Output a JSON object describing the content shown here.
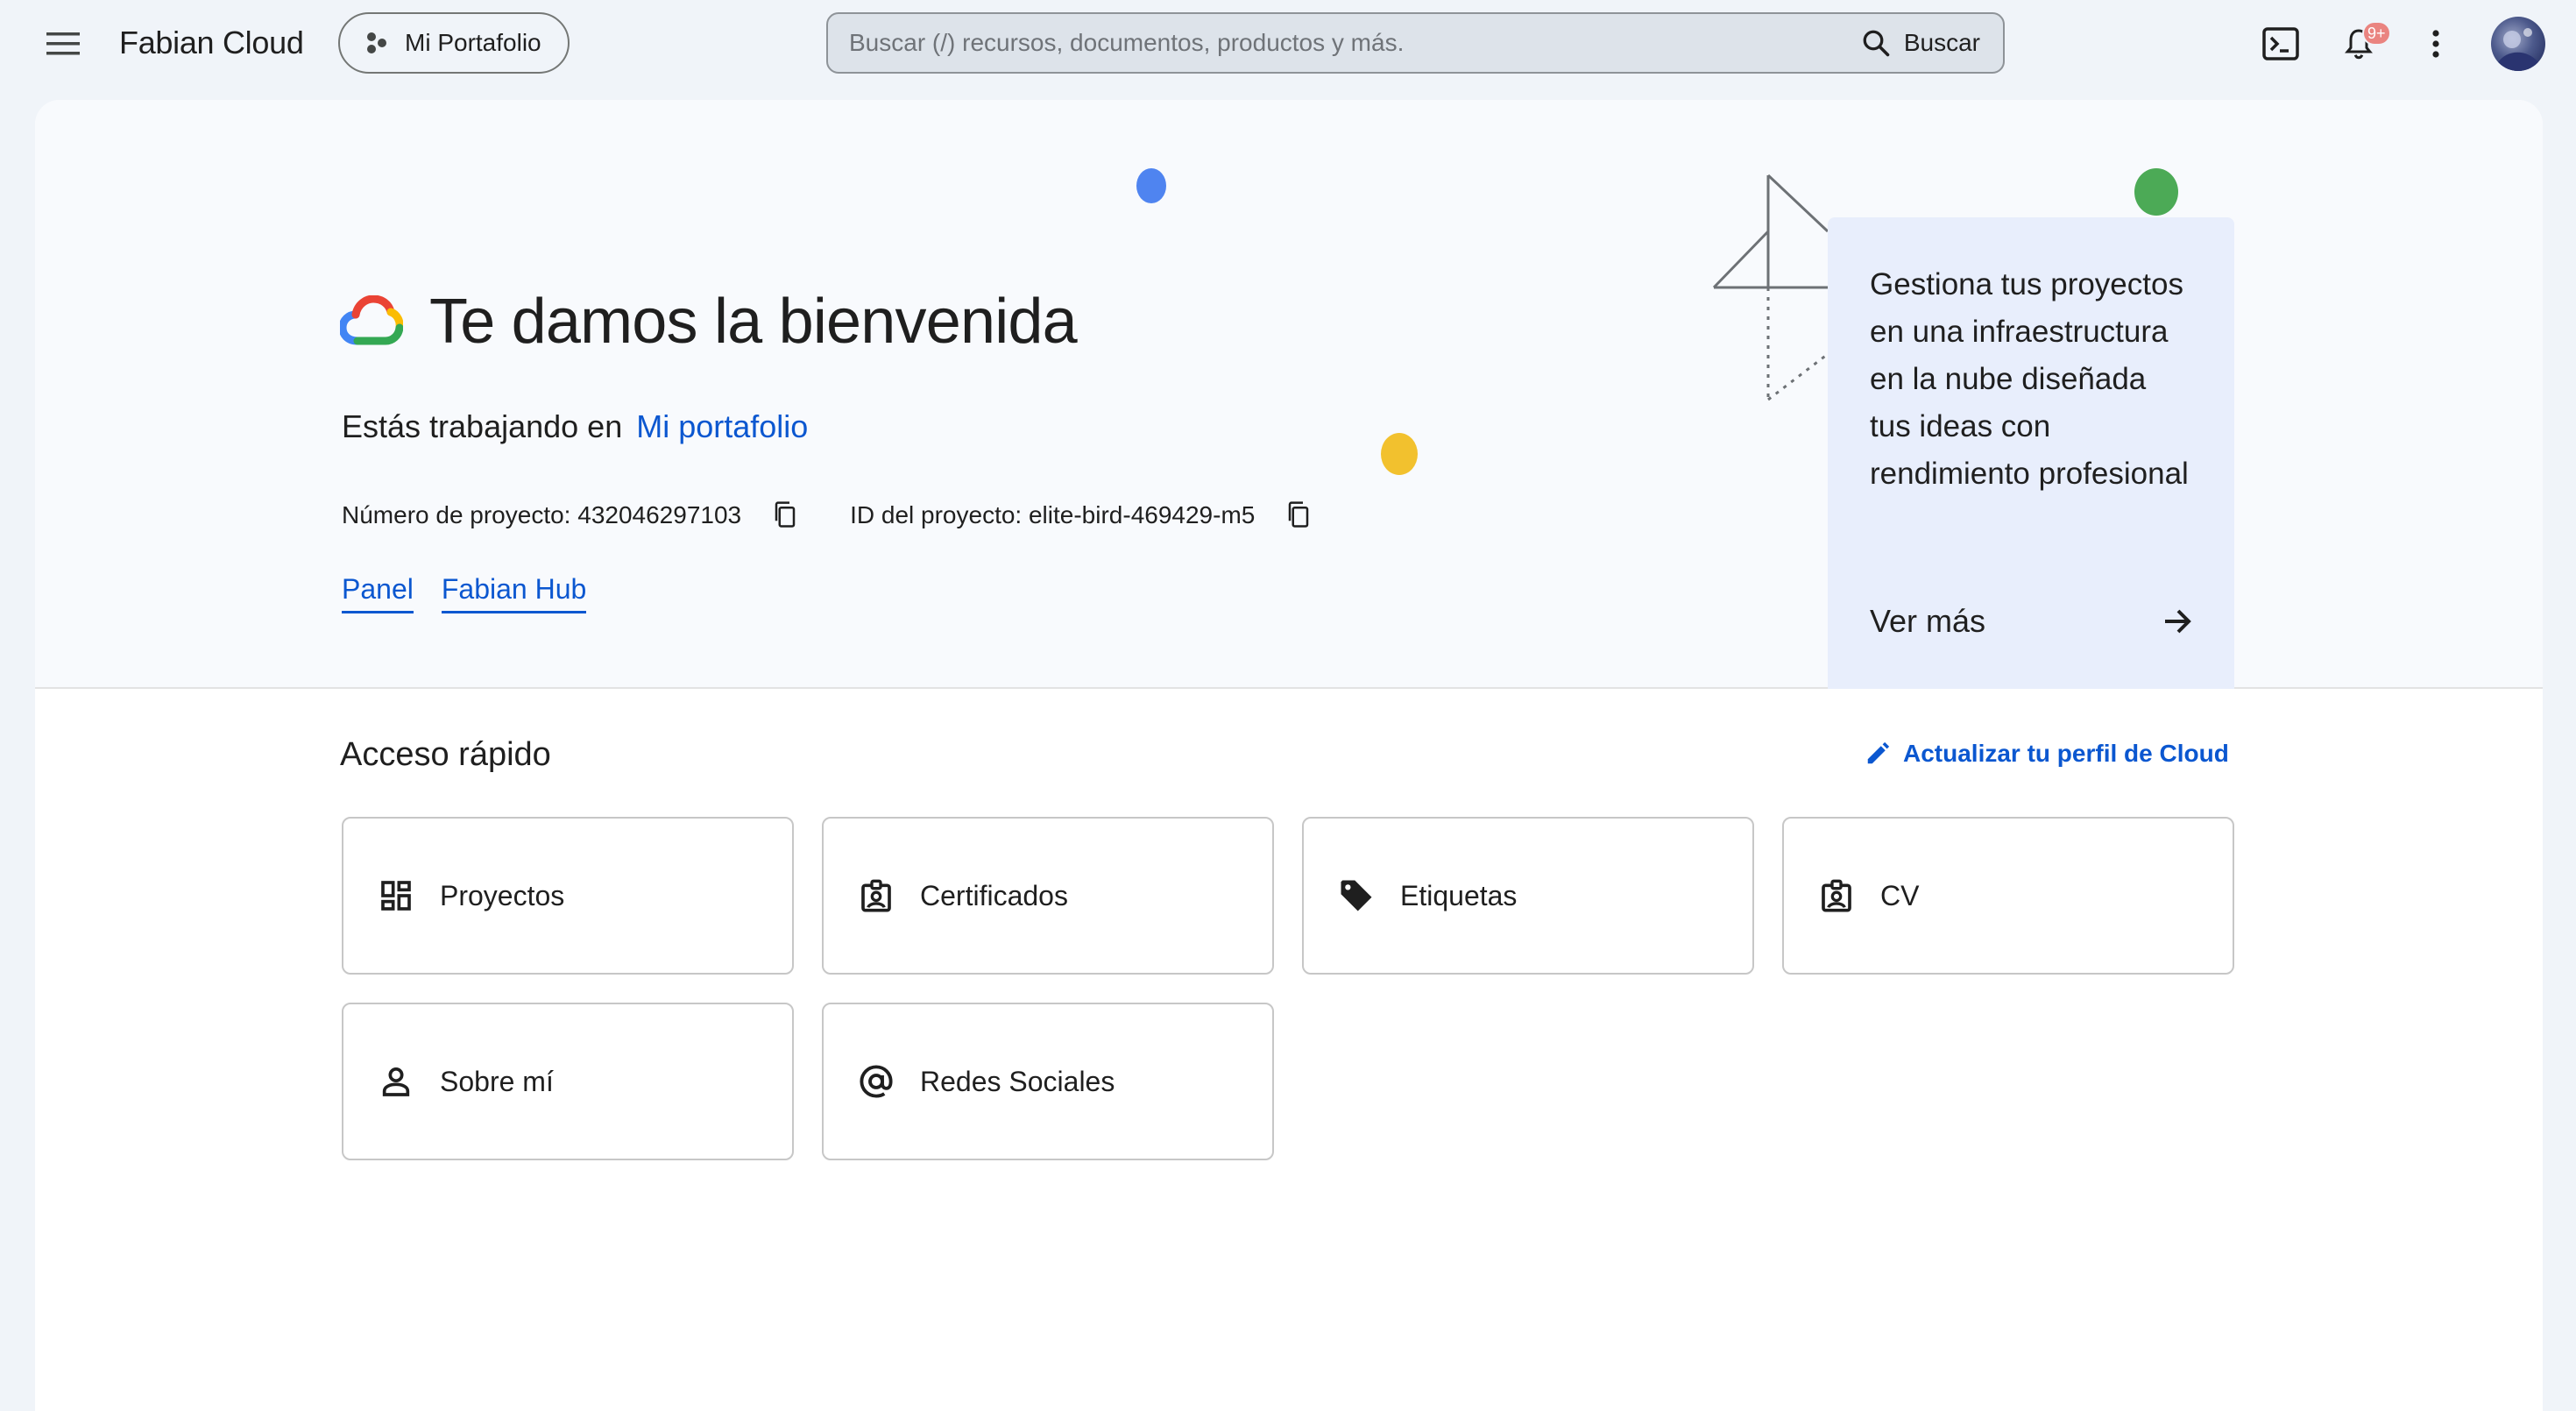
{
  "header": {
    "app_title": "Fabian Cloud",
    "project_chip_label": "Mi Portafolio",
    "search_placeholder": "Buscar (/) recursos, documentos, productos y más.",
    "search_button_label": "Buscar",
    "notification_badge": "9+",
    "icons": [
      "menu-icon",
      "project-icon",
      "search-icon",
      "terminal-icon",
      "bell-icon",
      "more-vert-icon",
      "avatar"
    ]
  },
  "hero": {
    "welcome_title": "Te damos la bienvenida",
    "working_prefix": "Estás trabajando en",
    "working_project_link": "Mi portafolio",
    "project_number_label": "Número de proyecto: 432046297103",
    "project_id_label": "ID del proyecto: elite-bird-469429-m5",
    "links": [
      "Panel",
      "Fabian Hub"
    ],
    "decorative_dot_colors": [
      "#4f84f0",
      "#f2c12e",
      "#4caa56"
    ]
  },
  "promo": {
    "text": "Gestiona tus proyectos en una infraestructura en la nube diseñada tus ideas con rendimiento profesional",
    "more_label": "Ver más"
  },
  "quick_access": {
    "title": "Acceso rápido",
    "edit_link": "Actualizar tu perfil de Cloud",
    "tiles": [
      {
        "label": "Proyectos",
        "icon": "dashboard-icon"
      },
      {
        "label": "Certificados",
        "icon": "badge-icon"
      },
      {
        "label": "Etiquetas",
        "icon": "tag-icon"
      },
      {
        "label": "CV",
        "icon": "badge-icon"
      },
      {
        "label": "Sobre mí",
        "icon": "person-icon"
      },
      {
        "label": "Redes Sociales",
        "icon": "at-icon"
      }
    ]
  },
  "colors": {
    "accent_blue": "#0b57d0",
    "page_bg": "#f0f4f9",
    "hero_bg": "#f8fafd",
    "promo_bg": "#e8eefc"
  }
}
